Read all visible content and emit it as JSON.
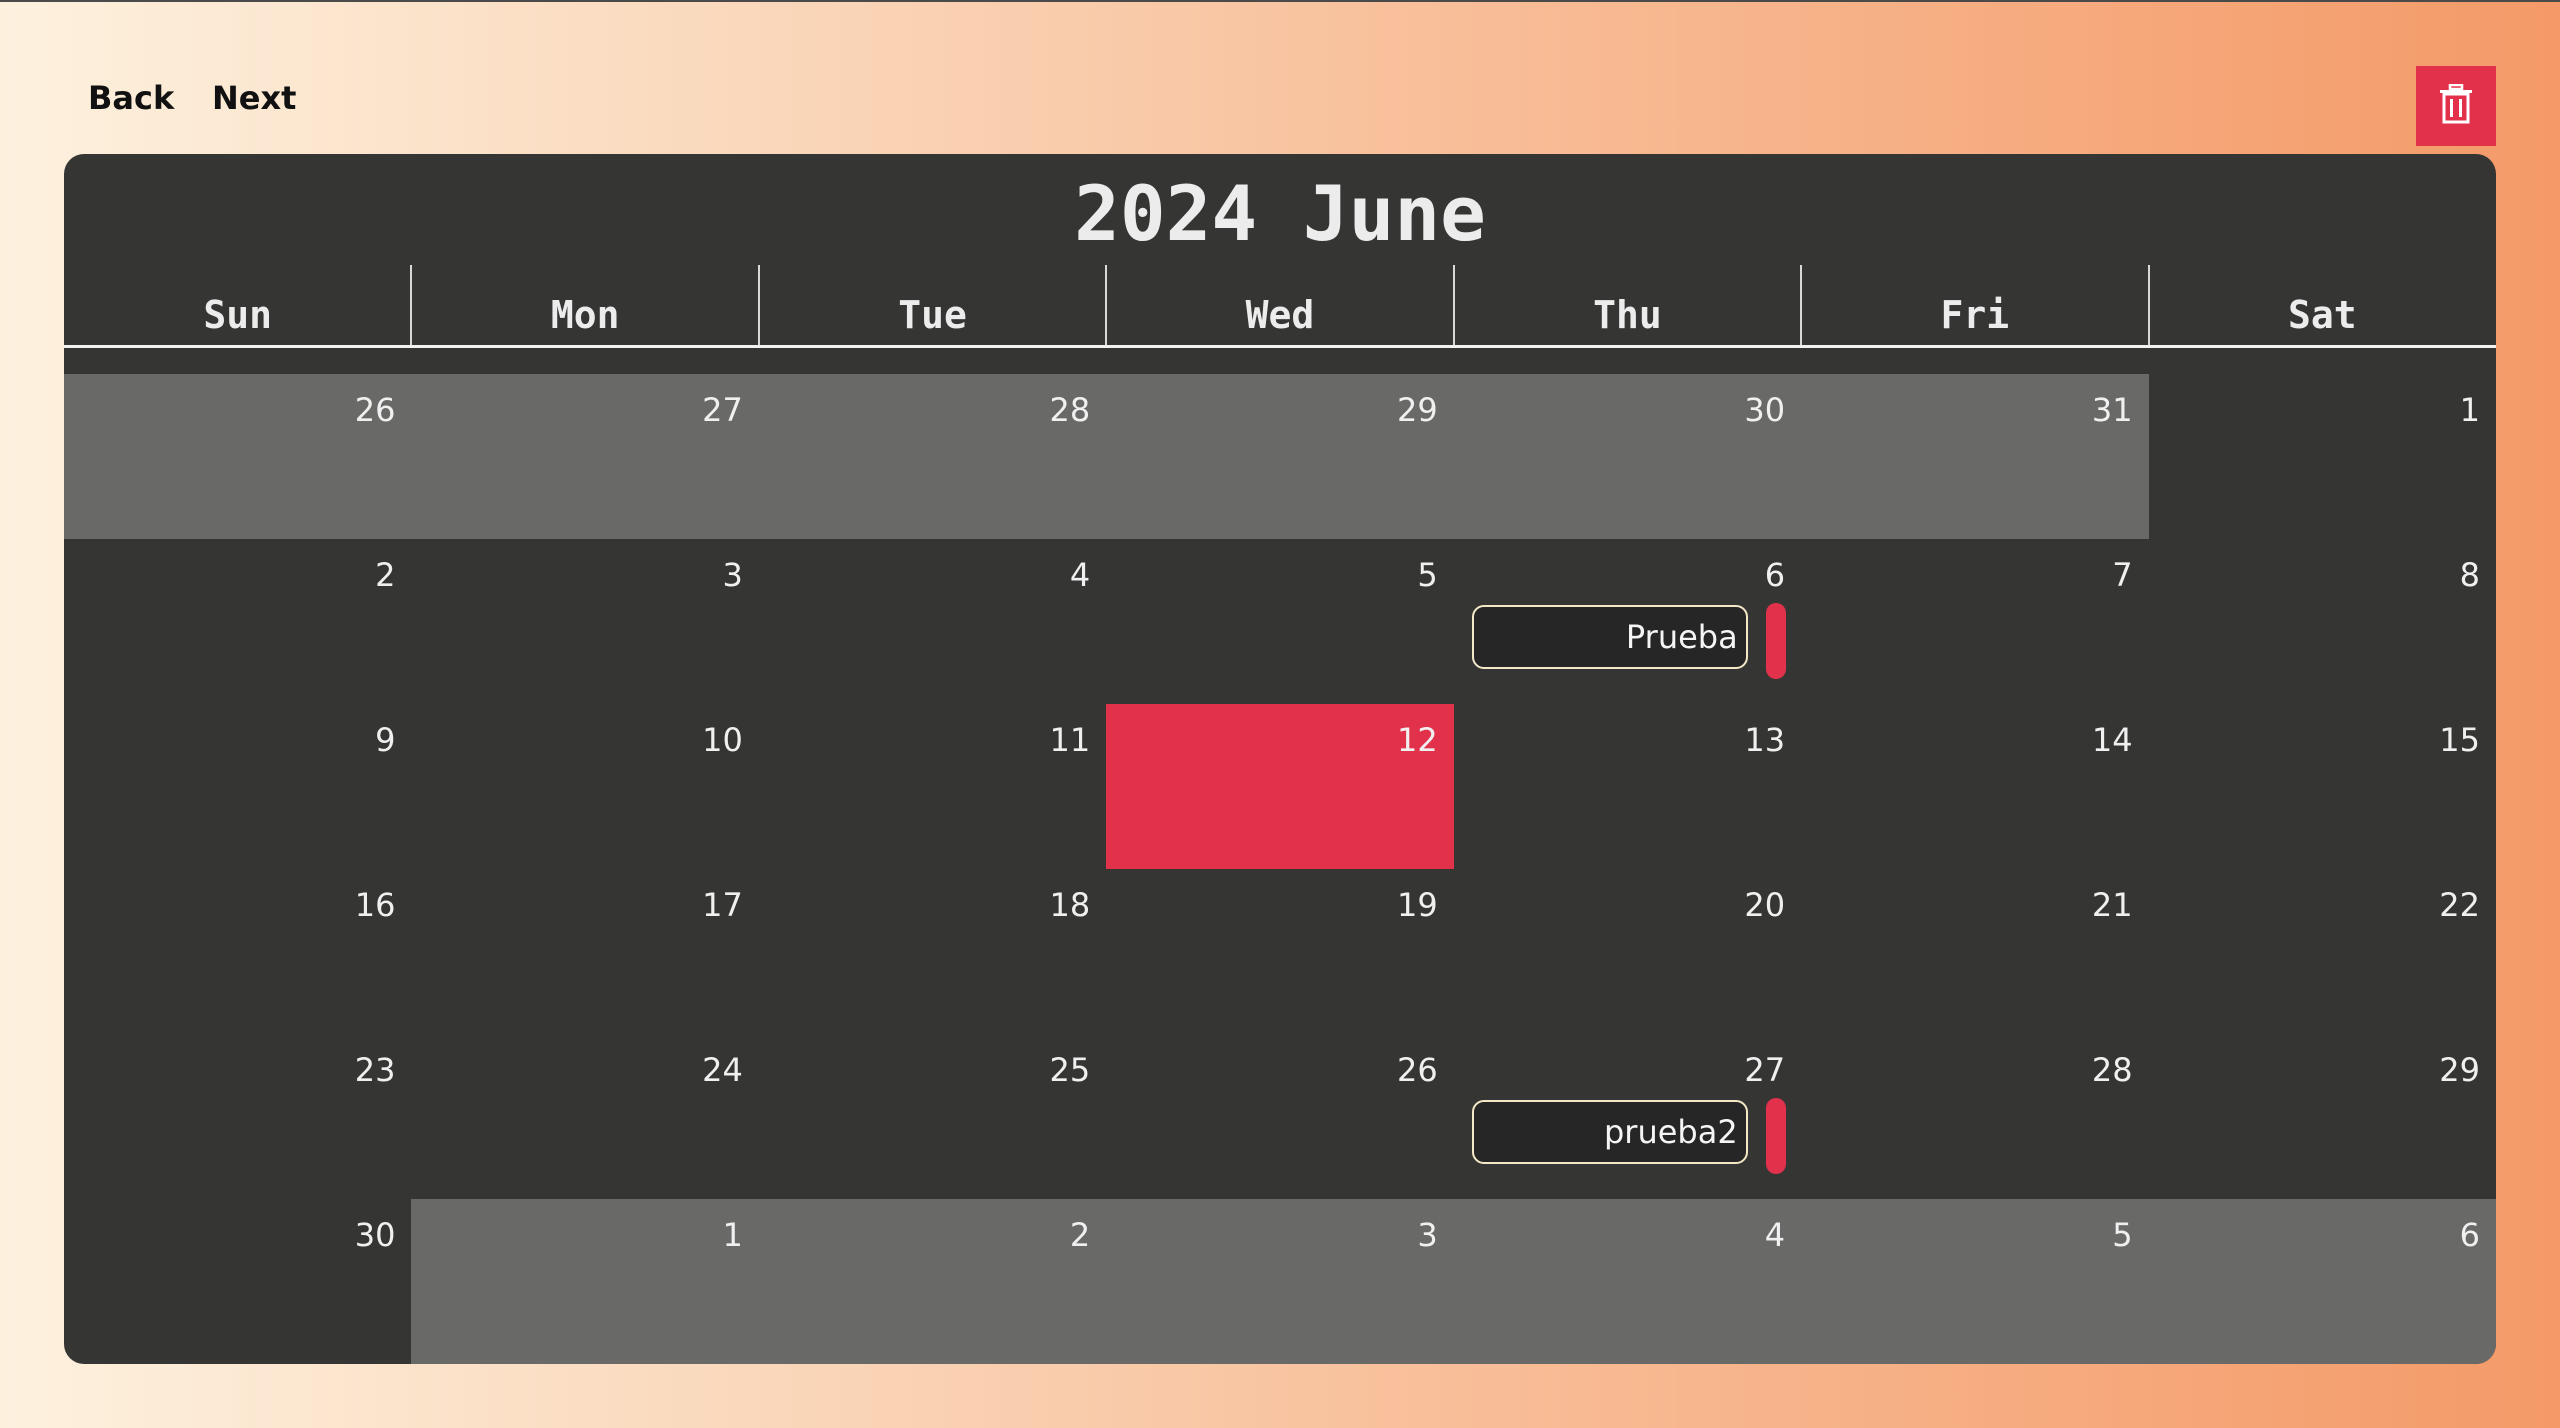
{
  "nav": {
    "back_label": "Back",
    "next_label": "Next",
    "delete_icon": "trash-icon"
  },
  "calendar": {
    "title": "2024 June",
    "weekdays": [
      "Sun",
      "Mon",
      "Tue",
      "Wed",
      "Thu",
      "Fri",
      "Sat"
    ],
    "weeks": [
      [
        {
          "day": "26",
          "outside": true
        },
        {
          "day": "27",
          "outside": true
        },
        {
          "day": "28",
          "outside": true
        },
        {
          "day": "29",
          "outside": true
        },
        {
          "day": "30",
          "outside": true
        },
        {
          "day": "31",
          "outside": true
        },
        {
          "day": "1",
          "outside": false
        }
      ],
      [
        {
          "day": "2",
          "outside": false
        },
        {
          "day": "3",
          "outside": false
        },
        {
          "day": "4",
          "outside": false
        },
        {
          "day": "5",
          "outside": false
        },
        {
          "day": "6",
          "outside": false
        },
        {
          "day": "7",
          "outside": false
        },
        {
          "day": "8",
          "outside": false
        }
      ],
      [
        {
          "day": "9",
          "outside": false
        },
        {
          "day": "10",
          "outside": false
        },
        {
          "day": "11",
          "outside": false
        },
        {
          "day": "12",
          "outside": false,
          "today": true
        },
        {
          "day": "13",
          "outside": false
        },
        {
          "day": "14",
          "outside": false
        },
        {
          "day": "15",
          "outside": false
        }
      ],
      [
        {
          "day": "16",
          "outside": false
        },
        {
          "day": "17",
          "outside": false
        },
        {
          "day": "18",
          "outside": false
        },
        {
          "day": "19",
          "outside": false
        },
        {
          "day": "20",
          "outside": false
        },
        {
          "day": "21",
          "outside": false
        },
        {
          "day": "22",
          "outside": false
        }
      ],
      [
        {
          "day": "23",
          "outside": false
        },
        {
          "day": "24",
          "outside": false
        },
        {
          "day": "25",
          "outside": false
        },
        {
          "day": "26",
          "outside": false
        },
        {
          "day": "27",
          "outside": false
        },
        {
          "day": "28",
          "outside": false
        },
        {
          "day": "29",
          "outside": false
        }
      ],
      [
        {
          "day": "30",
          "outside": false
        },
        {
          "day": "1",
          "outside": true
        },
        {
          "day": "2",
          "outside": true
        },
        {
          "day": "3",
          "outside": true
        },
        {
          "day": "4",
          "outside": true
        },
        {
          "day": "5",
          "outside": true
        },
        {
          "day": "6",
          "outside": true
        }
      ]
    ],
    "events": [
      {
        "label": "Prueba",
        "week": 1,
        "weekday": "Thu"
      },
      {
        "label": "prueba2",
        "week": 4,
        "weekday": "Thu"
      }
    ]
  },
  "colors": {
    "accent": "#e2324b",
    "calendar_bg": "#353533",
    "outside_day_bg": "#696968",
    "event_border": "#f3e9c8"
  }
}
